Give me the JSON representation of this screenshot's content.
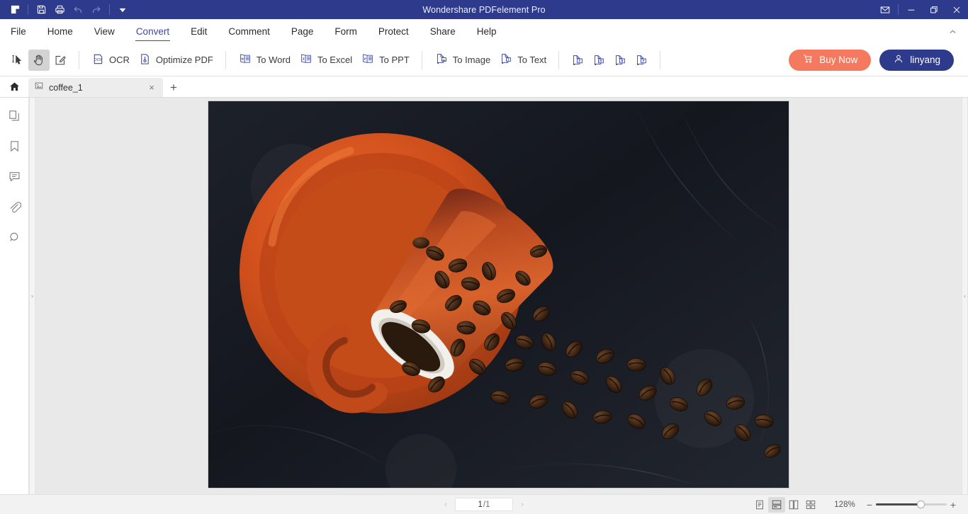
{
  "titlebar": {
    "app_title": "Wondershare PDFelement Pro",
    "accent_color": "#2e3a8c",
    "quick_access": [
      {
        "name": "logo-icon",
        "label": "PDFelement"
      },
      {
        "name": "save-icon",
        "label": "Save"
      },
      {
        "name": "print-icon",
        "label": "Print"
      },
      {
        "name": "undo-icon",
        "label": "Undo"
      },
      {
        "name": "redo-icon",
        "label": "Redo"
      },
      {
        "name": "customize-dropdown-icon",
        "label": "Customize Quick Access Toolbar"
      }
    ],
    "window_controls": [
      {
        "name": "mail-icon",
        "label": "Feedback"
      },
      {
        "name": "minimize-icon",
        "label": "Minimize"
      },
      {
        "name": "restore-icon",
        "label": "Restore"
      },
      {
        "name": "close-icon",
        "label": "Close"
      }
    ]
  },
  "menubar": {
    "items": [
      {
        "label": "File",
        "active": false
      },
      {
        "label": "Home",
        "active": false
      },
      {
        "label": "View",
        "active": false
      },
      {
        "label": "Convert",
        "active": true
      },
      {
        "label": "Edit",
        "active": false
      },
      {
        "label": "Comment",
        "active": false
      },
      {
        "label": "Page",
        "active": false
      },
      {
        "label": "Form",
        "active": false
      },
      {
        "label": "Protect",
        "active": false
      },
      {
        "label": "Share",
        "active": false
      },
      {
        "label": "Help",
        "active": false
      }
    ],
    "collapse_label": "Collapse Ribbon"
  },
  "ribbon": {
    "tools": [
      {
        "label": "",
        "icon": "select-text-cursor-icon",
        "selected": false
      },
      {
        "label": "",
        "icon": "hand-tool-icon",
        "selected": true
      },
      {
        "label": "",
        "icon": "edit-annotate-icon",
        "selected": false
      }
    ],
    "convert_group_a": [
      {
        "label": "OCR",
        "icon": "ocr-icon"
      },
      {
        "label": "Optimize PDF",
        "icon": "optimize-pdf-icon"
      }
    ],
    "convert_group_b": [
      {
        "label": "To Word",
        "icon": "to-word-icon"
      },
      {
        "label": "To Excel",
        "icon": "to-excel-icon"
      },
      {
        "label": "To PPT",
        "icon": "to-ppt-icon"
      }
    ],
    "convert_group_c": [
      {
        "label": "To Image",
        "icon": "to-image-icon"
      },
      {
        "label": "To Text",
        "icon": "to-text-icon"
      }
    ],
    "convert_group_d": [
      {
        "label": "",
        "icon": "to-epub-icon",
        "glyph": "E"
      },
      {
        "label": "",
        "icon": "to-html-icon",
        "glyph": "H"
      },
      {
        "label": "",
        "icon": "to-rtf-icon",
        "glyph": "R"
      },
      {
        "label": "",
        "icon": "to-pdfa-icon",
        "glyph": "P"
      }
    ],
    "buy_button": {
      "label": "Buy Now",
      "icon": "cart-icon",
      "color": "#f4795e"
    },
    "account_button": {
      "label": "linyang",
      "icon": "user-icon",
      "color": "#2e3a8c"
    }
  },
  "tabstrip": {
    "home_icon": "home-icon",
    "tabs": [
      {
        "label": "coffee_1",
        "icon": "pdf-file-icon",
        "close_label": "×",
        "active": true
      }
    ],
    "add_tab_label": "+"
  },
  "sidebar": {
    "items": [
      {
        "name": "panel-thumbnails",
        "icon": "pages-thumbnail-icon",
        "label": "Thumbnails"
      },
      {
        "name": "panel-bookmarks",
        "icon": "bookmark-icon",
        "label": "Bookmarks"
      },
      {
        "name": "panel-comments",
        "icon": "comment-icon",
        "label": "Comments"
      },
      {
        "name": "panel-attachments",
        "icon": "paperclip-icon",
        "label": "Attachments"
      },
      {
        "name": "panel-search",
        "icon": "search-icon",
        "label": "Search"
      }
    ],
    "left_handle": "›",
    "right_handle": "‹"
  },
  "document": {
    "page_background": "#1b1f27",
    "alt": "Orange coffee cup tipped over on saucer with roasted coffee beans spilling across dark slate"
  },
  "statusbar": {
    "prev_label": "‹",
    "next_label": "›",
    "current_page": "1",
    "page_total": "/1",
    "view_modes": [
      {
        "name": "view-single-page",
        "label": "Single Page",
        "selected": false
      },
      {
        "name": "view-continuous",
        "label": "Continuous",
        "selected": true
      },
      {
        "name": "view-facing",
        "label": "Facing",
        "selected": false
      },
      {
        "name": "view-grid",
        "label": "Grid",
        "selected": false
      }
    ],
    "zoom_level": "128%",
    "zoom_out_label": "−",
    "zoom_in_label": "+"
  }
}
